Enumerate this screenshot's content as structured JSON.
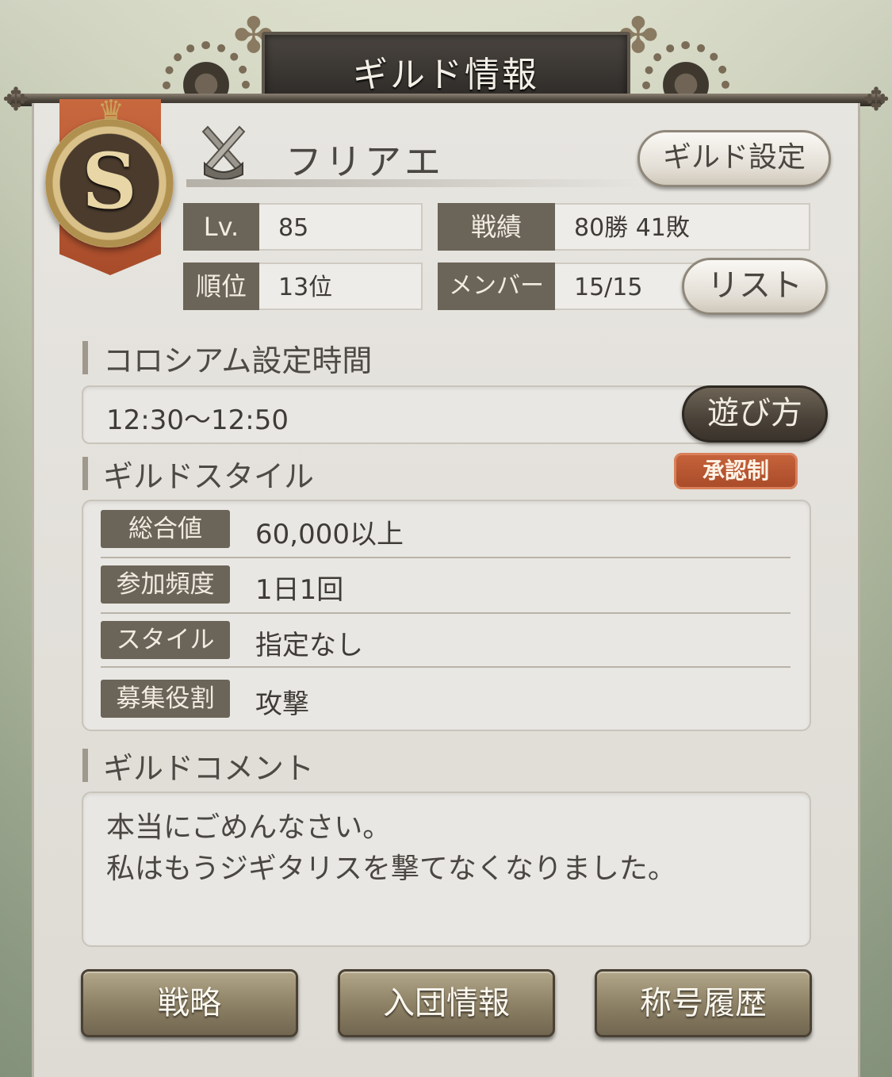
{
  "header": {
    "title": "ギルド情報"
  },
  "guild": {
    "rank_letter": "S",
    "name": "フリアエ",
    "settings_button": "ギルド設定",
    "level_label": "Lv.",
    "level_value": "85",
    "record_label": "戦績",
    "record_value": "80勝 41敗",
    "rank_label": "順位",
    "rank_value": "13位",
    "members_label": "メンバー",
    "members_value": "15/15",
    "list_button": "リスト"
  },
  "colosseum": {
    "heading": "コロシアム設定時間",
    "time": "12:30〜12:50",
    "howto_button": "遊び方"
  },
  "style": {
    "heading": "ギルドスタイル",
    "approval_badge": "承認制",
    "rows": [
      {
        "label": "総合値",
        "value": "60,000以上"
      },
      {
        "label": "参加頻度",
        "value": "1日1回"
      },
      {
        "label": "スタイル",
        "value": "指定なし"
      },
      {
        "label": "募集役割",
        "value": "攻撃"
      }
    ]
  },
  "comment": {
    "heading": "ギルドコメント",
    "text": "本当にごめんなさい。\n私はもうジギタリスを撃てなくなりました。"
  },
  "footer": {
    "buttons": [
      "戦略",
      "入団情報",
      "称号履歴"
    ]
  },
  "colors": {
    "label_bg": "#6b6458",
    "panel_bg": "#e7e5e0",
    "badge": "#b8532f",
    "bottom_button": "#8b7f64"
  }
}
